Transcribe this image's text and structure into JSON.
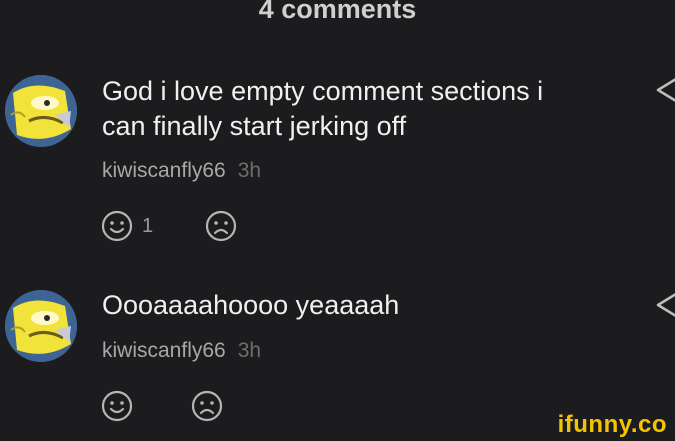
{
  "header": {
    "title": "4 comments"
  },
  "comments": [
    {
      "text_line1": "God i love empty comment sections i",
      "text_line2": "can finally start jerking off",
      "username": "kiwiscanfly66",
      "time": "3h",
      "like_count": "1"
    },
    {
      "text_line1": "Oooaaaahoooo yeaaaah",
      "username": "kiwiscanfly66",
      "time": "3h",
      "like_count": ""
    }
  ],
  "icons": {
    "avatar": "spongebob-face-avatar",
    "share": "share-icon",
    "like": "smile-icon",
    "dislike": "frown-icon"
  },
  "watermark": {
    "text": "ifunny.co",
    "color": "#f2c500"
  },
  "colors": {
    "background": "#1c1c1e",
    "text": "#f0f0f0",
    "meta": "#a8a8a8"
  }
}
